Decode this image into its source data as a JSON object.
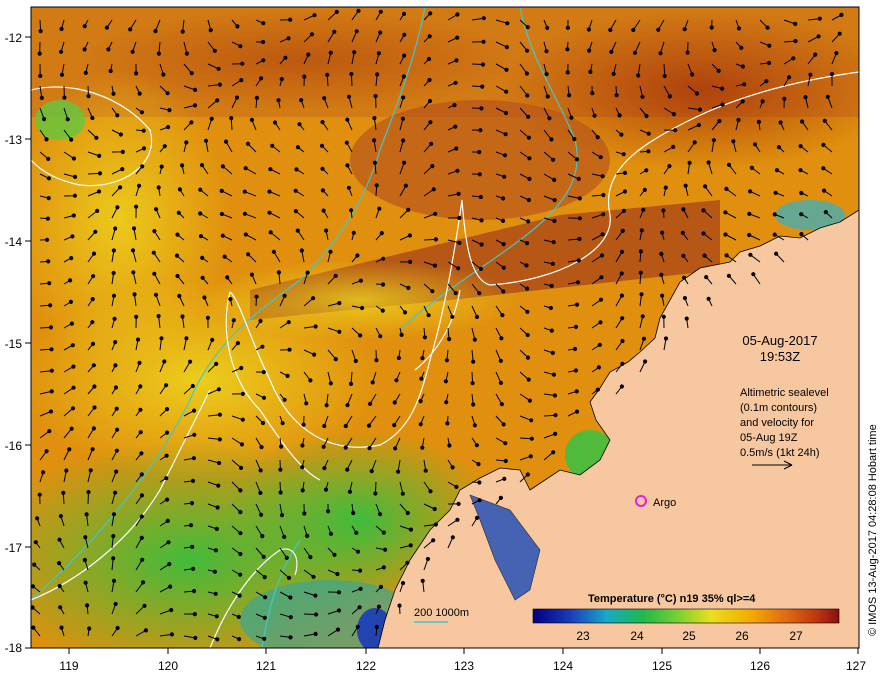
{
  "map": {
    "x_ticks": [
      "119",
      "120",
      "121",
      "122",
      "123",
      "124",
      "125",
      "126",
      "127"
    ],
    "y_ticks": [
      "-12",
      "-13",
      "-14",
      "-15",
      "-16",
      "-17",
      "-18"
    ],
    "date_line1": "05-Aug-2017",
    "date_line2": "19:53Z",
    "altimetry_lines": [
      "Altimetric sealevel",
      "(0.1m contours)",
      "and velocity for",
      "05-Aug 19Z",
      "0.5m/s (1kt 24h)"
    ],
    "argo_label": "Argo",
    "contour_legend": "200  1000m",
    "colorbar_title": "Temperature (°C) n19 35% ql>=4",
    "colorbar_ticks": [
      "23",
      "24",
      "25",
      "26",
      "27"
    ],
    "credit": "© IMOS 13-Aug-2017 04:28:08 Hobart time",
    "colors": {
      "land": "#f7c7a0",
      "warm": "#d2691e",
      "hot": "#a0300c",
      "mid": "#f5a800",
      "yellow": "#f2e020",
      "green": "#52c83a",
      "cool": "#1fb2c8",
      "cold": "#1a3ab8",
      "argo_marker": "#e020e0",
      "contour_shelf": "#40c8c8",
      "sealevel_contour": "#ffffff"
    }
  }
}
